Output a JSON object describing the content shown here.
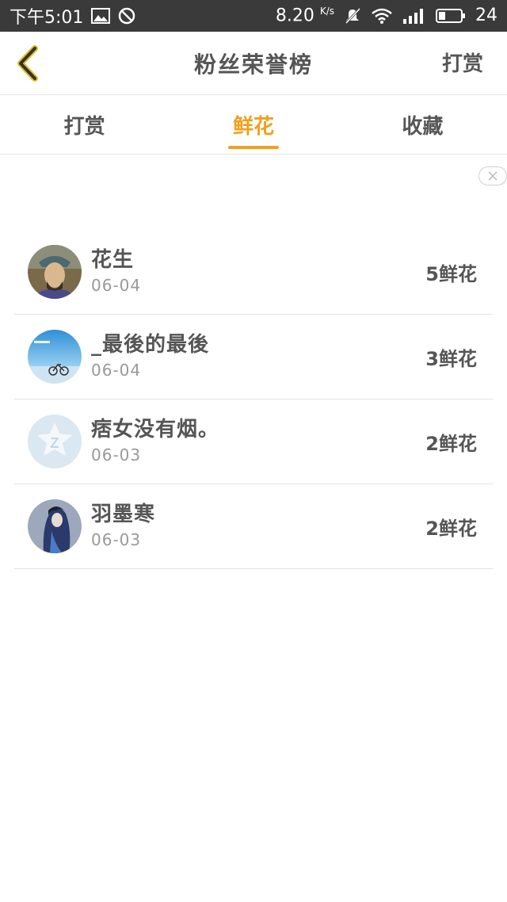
{
  "status_bar": {
    "time": "下午5:01",
    "net_speed": "8.20",
    "net_unit": "K/s",
    "battery": "24"
  },
  "header": {
    "title": "粉丝荣誉榜",
    "action": "打赏"
  },
  "tabs": [
    {
      "label": "打赏",
      "active": false
    },
    {
      "label": "鲜花",
      "active": true
    },
    {
      "label": "收藏",
      "active": false
    }
  ],
  "list": [
    {
      "name": "花生",
      "date": "06-04",
      "count": "5鲜花",
      "avatar": "portrait-warrior"
    },
    {
      "name": "_最後的最後",
      "date": "06-04",
      "count": "3鲜花",
      "avatar": "sky-bicycle"
    },
    {
      "name": "痞女没有烟。",
      "date": "06-03",
      "count": "2鲜花",
      "avatar": "qzone-default"
    },
    {
      "name": "羽墨寒",
      "date": "06-03",
      "count": "2鲜花",
      "avatar": "anime-girl"
    }
  ],
  "colors": {
    "accent": "#f0a020",
    "status_bar_bg": "#3a3a3a",
    "text": "#555555",
    "muted": "#999999"
  }
}
